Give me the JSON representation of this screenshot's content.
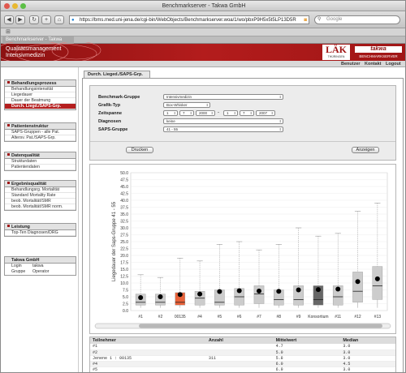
{
  "window": {
    "title": "Benchmarkserver - Takwa GmbH",
    "url": "https://bms.med.uni-jena.de/cgi-bin/WebObjects/Benchmarkserver.woa/1/wo/pbxP9H5x5t5LP13D5R",
    "search_placeholder": "Google",
    "tab_label": "Benchmarkserver - Takwa GmbH"
  },
  "banner": {
    "title_line1": "Qualitätsmanagement",
    "title_line2": "Intensivmedizin",
    "laek_logo": "LÄK",
    "laek_sub": "THÜRINGEN",
    "takwa_logo": "takwa",
    "benchmark_logo": "BENCHMARKSERVER"
  },
  "nav": {
    "benutzer": "Benutzer",
    "kontakt": "Kontakt",
    "logout": "Logout"
  },
  "sidebar": {
    "sections": [
      {
        "title": "Behandlungsprozess",
        "items": [
          {
            "label": "Behandlungsintensität",
            "selected": false
          },
          {
            "label": "Liegedauer",
            "selected": false
          },
          {
            "label": "Dauer der Beatmung",
            "selected": false
          },
          {
            "label": "Durch. Liegd./SAPS-Grp.",
            "selected": true
          }
        ]
      },
      {
        "title": "Patientenstruktur",
        "items": [
          {
            "label": "SAPS-Gruppen - alle Pat.",
            "selected": false
          },
          {
            "label": "Altersv. Pat./SAPS-Grp.",
            "selected": false
          }
        ]
      },
      {
        "title": "Datenqualität",
        "items": [
          {
            "label": "Strukturdaten",
            "selected": false
          },
          {
            "label": "Patientendaten",
            "selected": false
          }
        ]
      },
      {
        "title": "Ergebnisqualität",
        "items": [
          {
            "label": "Behandlungsrg. Mortalität",
            "selected": false
          },
          {
            "label": "Standard Mortality Rate",
            "selected": false
          },
          {
            "label": "beob. Mortalität/SMR",
            "selected": false
          },
          {
            "label": "beob. Mortalität/SMR norm.",
            "selected": false
          }
        ]
      },
      {
        "title": "Leistung",
        "items": [
          {
            "label": "Top-Ten Diagnosen/DRG",
            "selected": false
          }
        ]
      }
    ],
    "company": {
      "title": "Takwa GmbH",
      "login_label": "Login",
      "login_value": "takwa",
      "gruppe_label": "Gruppe",
      "gruppe_value": "Operator"
    }
  },
  "main": {
    "tab_label": "Durch. Lieged./SAPS-Grp.",
    "form": {
      "benchmark_label": "Benchmark-Gruppe",
      "benchmark_value": "Intensivmedizin",
      "grafik_label": "Grafik-Typ",
      "grafik_value": "Box-Whisker",
      "zeitspanne_label": "Zeitspanne",
      "zeit_from": [
        "1",
        "7",
        "2000"
      ],
      "zeit_sep": "-",
      "zeit_to": [
        "1",
        "7",
        "2007"
      ],
      "diagnosen_label": "Diagnosen",
      "diagnosen_value": "keine",
      "saps_label": "SAPS-Gruppe",
      "saps_value": "41 - 55",
      "drucken_button": "Drucken",
      "anzeigen_button": "Anzeigen"
    },
    "table": {
      "headers": [
        "Teilnehmer",
        "Anzahl",
        "Mittelwert",
        "Median"
      ],
      "rows": [
        [
          "#1",
          "",
          "4.7",
          "3.0"
        ],
        [
          "#2",
          "",
          "5.0",
          "3.0"
        ],
        [
          "Jenene 1 : 00135",
          "311",
          "5.8",
          "3.0"
        ],
        [
          "#4",
          "",
          "6.0",
          "4.5"
        ],
        [
          "#5",
          "",
          "6.9",
          "3.0"
        ]
      ]
    }
  },
  "chart_data": {
    "type": "boxplot",
    "ylabel": "Liegedauer der Saps-Gruppe 41 - 55",
    "ylim": [
      0,
      50
    ],
    "yticks": [
      0,
      2.5,
      5,
      7.5,
      10,
      12.5,
      15,
      17.5,
      20,
      22.5,
      25,
      27.5,
      30,
      32.5,
      35,
      37.5,
      40,
      42.5,
      45,
      47.5,
      50
    ],
    "categories": [
      "#1",
      "#2",
      "00135",
      "#4",
      "#5",
      "#6",
      "#7",
      "#8",
      "#9",
      "Konsortium",
      "#11",
      "#12",
      "#13"
    ],
    "series": [
      {
        "min": 1,
        "q1": 2,
        "median": 3,
        "q3": 6,
        "max": 13,
        "mean": 4.7,
        "color": "#cccccc"
      },
      {
        "min": 1,
        "q1": 2,
        "median": 3,
        "q3": 6,
        "max": 12,
        "mean": 5.0,
        "color": "#cccccc"
      },
      {
        "min": 1,
        "q1": 2,
        "median": 3,
        "q3": 6.5,
        "max": 19,
        "mean": 5.8,
        "color": "#e8623a"
      },
      {
        "min": 1,
        "q1": 2,
        "median": 4.5,
        "q3": 7,
        "max": 18,
        "mean": 6.0,
        "color": "#cccccc"
      },
      {
        "min": 1,
        "q1": 2,
        "median": 3,
        "q3": 7.5,
        "max": 24,
        "mean": 6.9,
        "color": "#cccccc"
      },
      {
        "min": 1,
        "q1": 2,
        "median": 5,
        "q3": 8,
        "max": 25,
        "mean": 7.2,
        "color": "#cccccc"
      },
      {
        "min": 1,
        "q1": 2.5,
        "median": 6,
        "q3": 9,
        "max": 22,
        "mean": 7.1,
        "color": "#cccccc"
      },
      {
        "min": 1,
        "q1": 2,
        "median": 4,
        "q3": 7.5,
        "max": 24,
        "mean": 7.0,
        "color": "#cccccc"
      },
      {
        "min": 1,
        "q1": 2,
        "median": 4,
        "q3": 9,
        "max": 30,
        "mean": 7.5,
        "color": "#cccccc"
      },
      {
        "min": 1,
        "q1": 2,
        "median": 4,
        "q3": 9,
        "max": 27,
        "mean": 7.6,
        "color": "#666666"
      },
      {
        "min": 1,
        "q1": 2,
        "median": 5,
        "q3": 9,
        "max": 28,
        "mean": 7.8,
        "color": "#cccccc"
      },
      {
        "min": 1,
        "q1": 3,
        "median": 7,
        "q3": 14,
        "max": 36,
        "mean": 10.5,
        "color": "#cccccc"
      },
      {
        "min": 1,
        "q1": 4,
        "median": 9,
        "q3": 16,
        "max": 39,
        "mean": 11.5,
        "color": "#cccccc"
      }
    ],
    "grid": true
  }
}
